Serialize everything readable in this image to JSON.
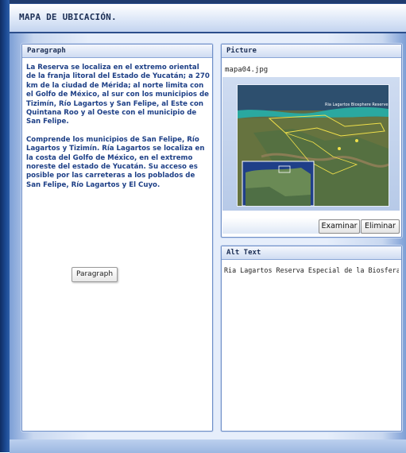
{
  "title": "MAPA DE UBICACIÓN.",
  "paragraph_panel": {
    "header": "Paragraph",
    "text_1": "La Reserva se localiza en el extremo oriental de la franja litoral del Estado de Yucatán; a 270 km de la ciudad de Mérida; al norte limita con el Golfo de México, al sur con los municipios de Tizimín, Río Lagartos y San Felipe, al Este con Quintana Roo y al Oeste con el municipio de San Felipe.",
    "text_2": "Comprende los municipios de San Felipe, Río Lagartos y Tizimín.  Ría Lagartos se localiza en la costa del Golfo de México, en el extremo noreste del estado de Yucatán. Su acceso es posible por las carreteras a los poblados de San Felipe, Río Lagartos y El Cuyo.",
    "button_label": "Paragraph"
  },
  "picture_panel": {
    "header": "Picture",
    "filename": "mapa04.jpg",
    "map_caption": "Ria Lagartos Biosphere Reserve",
    "browse_label": "Examinar",
    "delete_label": "Eliminar"
  },
  "alt_panel": {
    "header": "Alt Text",
    "value": "Ria Lagartos Reserva Especial de la Biosfera"
  }
}
